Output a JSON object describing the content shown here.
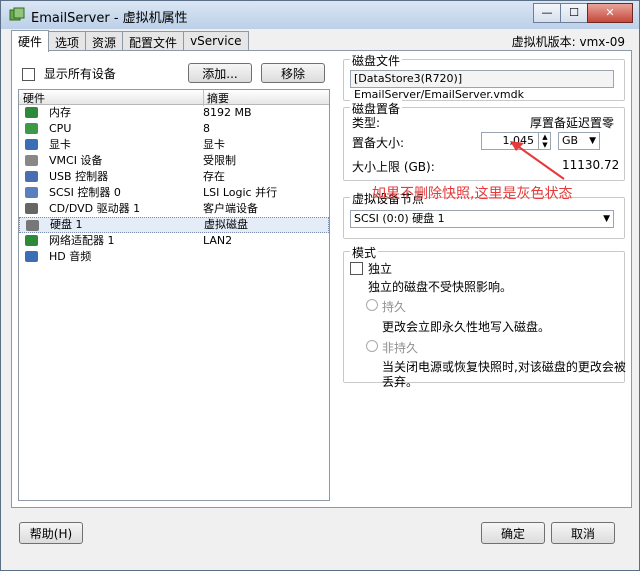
{
  "window": {
    "title": "EmailServer - 虚拟机属性",
    "minimize": "—",
    "maximize": "☐",
    "close": "✕"
  },
  "tabs": [
    {
      "label": "硬件",
      "active": true
    },
    {
      "label": "选项"
    },
    {
      "label": "资源"
    },
    {
      "label": "配置文件"
    },
    {
      "label": "vService"
    }
  ],
  "version_label": "虚拟机版本: vmx-09",
  "left": {
    "show_all_label": "显示所有设备",
    "add_button": "添加...",
    "remove_button": "移除",
    "columns": [
      "硬件",
      "摘要"
    ],
    "items": [
      {
        "name": "内存",
        "value": "8192 MB",
        "icon": "memory-icon",
        "color": "#2d8a3a"
      },
      {
        "name": "CPU",
        "value": "8",
        "icon": "cpu-icon",
        "color": "#3a9a4a"
      },
      {
        "name": "显卡",
        "value": "显卡",
        "icon": "display-icon",
        "color": "#3b6fb5"
      },
      {
        "name": "VMCI 设备",
        "value": "受限制",
        "icon": "vmci-icon",
        "color": "#888888"
      },
      {
        "name": "USB 控制器",
        "value": "存在",
        "icon": "usb-icon",
        "color": "#4a6fb0"
      },
      {
        "name": "SCSI 控制器 0",
        "value": "LSI Logic 并行",
        "icon": "scsi-icon",
        "color": "#5a7fc0"
      },
      {
        "name": "CD/DVD 驱动器 1",
        "value": "客户端设备",
        "icon": "cdrom-icon",
        "color": "#666666"
      },
      {
        "name": "硬盘 1",
        "value": "虚拟磁盘",
        "icon": "harddisk-icon",
        "color": "#777777",
        "selected": true
      },
      {
        "name": "网络适配器 1",
        "value": "LAN2",
        "icon": "network-icon",
        "color": "#2d8a3a"
      },
      {
        "name": "HD 音频",
        "value": "",
        "icon": "speaker-icon",
        "color": "#3b6fb5"
      }
    ]
  },
  "disk_file": {
    "title": "磁盘文件",
    "value": "[DataStore3(R720)] EmailServer/EmailServer.vmdk"
  },
  "provisioning": {
    "title": "磁盘置备",
    "type_label": "类型:",
    "type_value": "厚置备延迟置零",
    "size_label": "置备大小:",
    "size_value": "1,045",
    "unit": "GB",
    "max_label": "大小上限 (GB):",
    "max_value": "11130.72"
  },
  "annotation": "如果不删除快照,这里是灰色状态",
  "annotation_color": "#e53b3b",
  "vdev_node": {
    "title": "虚拟设备节点",
    "value": "SCSI (0:0) 硬盘 1"
  },
  "mode": {
    "title": "模式",
    "independent_label": "独立",
    "independent_desc": "独立的磁盘不受快照影响。",
    "persistent_label": "持久",
    "persistent_desc": "更改会立即永久性地写入磁盘。",
    "nonpersistent_label": "非持久",
    "nonpersistent_desc_1": "当关闭电源或恢复快照时,对该磁盘的更改会被",
    "nonpersistent_desc_2": "丢弃。"
  },
  "footer": {
    "help": "帮助(H)",
    "ok": "确定",
    "cancel": "取消"
  }
}
